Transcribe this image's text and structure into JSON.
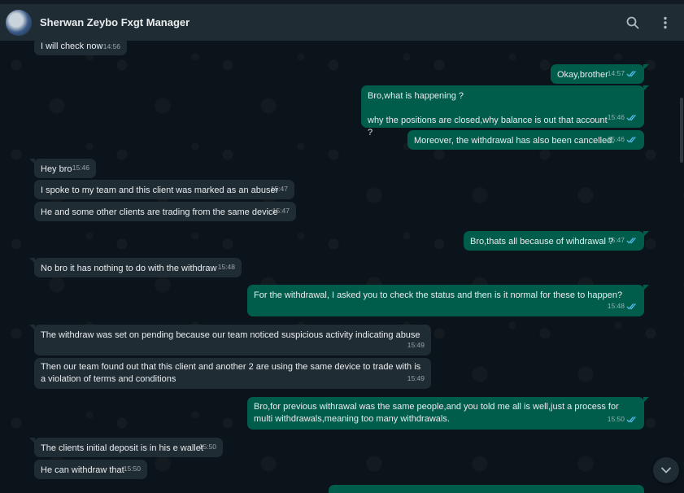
{
  "header": {
    "contact_name": "Sherwan Zeybo Fxgt Manager",
    "icons": [
      "search-icon",
      "menu-icon"
    ]
  },
  "colors": {
    "incoming_bubble": "#202c33",
    "outgoing_bubble": "#005c4b",
    "read_ticks": "#53bdeb"
  },
  "messages": [
    {
      "dir": "in",
      "text": "I will check now",
      "time": "14:56"
    },
    {
      "dir": "out",
      "text": "Okay,brother",
      "time": "14:57",
      "status": "read"
    },
    {
      "dir": "out",
      "text": "Bro,what is happening ?\n\nwhy the positions are closed,why balance is out that account ?",
      "time": "15:46",
      "status": "read"
    },
    {
      "dir": "out",
      "text": "Moreover, the withdrawal has also been cancelled.",
      "time": "15:46",
      "status": "read"
    },
    {
      "dir": "in",
      "text": "Hey bro",
      "time": "15:46"
    },
    {
      "dir": "in",
      "text": "I spoke to my team and this client was marked as an abuser",
      "time": "15:47"
    },
    {
      "dir": "in",
      "text": "He and some other clients are trading from the same device",
      "time": "15:47"
    },
    {
      "dir": "out",
      "text": "Bro,thats all because of wihdrawal ?",
      "time": "15:47",
      "status": "read"
    },
    {
      "dir": "in",
      "text": "No bro it has nothing to do with the withdraw",
      "time": "15:48"
    },
    {
      "dir": "out",
      "text": "For the withdrawal, I asked you to check the status and then is it normal for these to happen?",
      "time": "15:48",
      "status": "read"
    },
    {
      "dir": "in",
      "text": "The withdraw was set on pending because our team noticed suspicious activity indicating abuse",
      "time": "15:49"
    },
    {
      "dir": "in",
      "text": "Then our team found out that this client and another 2 are using the same device to trade with is a violation of terms and conditions",
      "time": "15:49"
    },
    {
      "dir": "out",
      "text": "Bro,for previous withrawal was the same people,and you told me all is well,just a process for multi withdrawals,meaning too many withdrawals.",
      "time": "15:50",
      "status": "read"
    },
    {
      "dir": "in",
      "text": "The clients initial deposit is in his e wallet",
      "time": "15:50"
    },
    {
      "dir": "in",
      "text": "He can withdraw that",
      "time": "15:50"
    }
  ]
}
